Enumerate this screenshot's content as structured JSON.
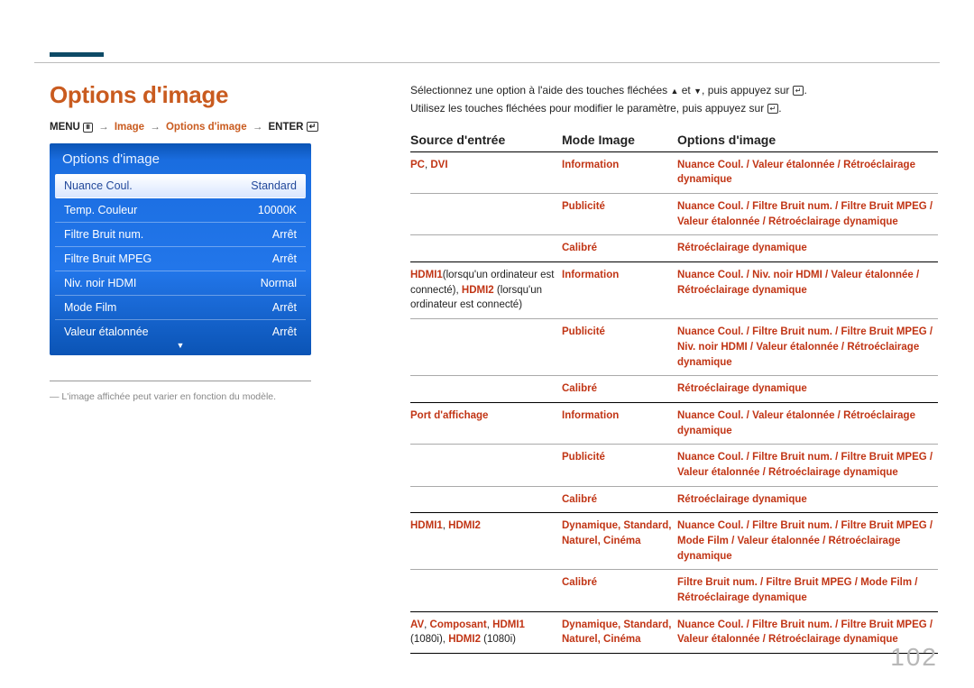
{
  "heading": "Options d'image",
  "breadcrumb": {
    "menu": "MENU",
    "image": "Image",
    "options": "Options d'image",
    "enter": "ENTER"
  },
  "panel": {
    "title": "Options d'image",
    "rows": [
      {
        "label": "Nuance Coul.",
        "value": "Standard",
        "selected": true
      },
      {
        "label": "Temp. Couleur",
        "value": "10000K"
      },
      {
        "label": "Filtre Bruit num.",
        "value": "Arrêt"
      },
      {
        "label": "Filtre Bruit MPEG",
        "value": "Arrêt"
      },
      {
        "label": "Niv. noir HDMI",
        "value": "Normal"
      },
      {
        "label": "Mode Film",
        "value": "Arrêt"
      },
      {
        "label": "Valeur étalonnée",
        "value": "Arrêt"
      }
    ]
  },
  "footnote": "― L'image affichée peut varier en fonction du modèle.",
  "desc": {
    "line1a": "Sélectionnez une option à l'aide des touches fléchées ",
    "line1b": " et ",
    "line1c": ", puis appuyez sur ",
    "line1d": ".",
    "line2a": "Utilisez les touches fléchées pour modifier le paramètre, puis appuyez sur ",
    "line2b": "."
  },
  "table": {
    "headers": {
      "c1": "Source d'entrée",
      "c2": "Mode Image",
      "c3": "Options d'image"
    },
    "groups": [
      {
        "source": [
          {
            "t": "PC",
            "r": true
          },
          {
            "t": ", ",
            "r": false
          },
          {
            "t": "DVI",
            "r": true
          }
        ],
        "rows": [
          {
            "mode": "Information",
            "opts": [
              {
                "t": "Nuance Coul.",
                "r": true
              },
              {
                "t": " / ",
                "r": true
              },
              {
                "t": "Valeur étalonnée",
                "r": true
              },
              {
                "t": " / ",
                "r": true
              },
              {
                "t": "Rétroéclairage dynamique",
                "r": true
              }
            ]
          },
          {
            "mode": "Publicité",
            "opts": [
              {
                "t": "Nuance Coul.",
                "r": true
              },
              {
                "t": " / ",
                "r": true
              },
              {
                "t": "Filtre Bruit num.",
                "r": true
              },
              {
                "t": " / ",
                "r": true
              },
              {
                "t": "Filtre Bruit MPEG",
                "r": true
              },
              {
                "t": " / ",
                "r": true
              },
              {
                "t": "Valeur étalonnée",
                "r": true
              },
              {
                "t": " / ",
                "r": true
              },
              {
                "t": "Rétroéclairage dynamique",
                "r": true
              }
            ]
          },
          {
            "mode": "Calibré",
            "opts": [
              {
                "t": "Rétroéclairage dynamique",
                "r": true
              }
            ]
          }
        ]
      },
      {
        "source": [
          {
            "t": "HDMI1",
            "r": true
          },
          {
            "t": "(lorsqu'un ordinateur est connecté), ",
            "r": false
          },
          {
            "t": "HDMI2",
            "r": true
          },
          {
            "t": " (lorsqu'un ordinateur est connecté)",
            "r": false
          }
        ],
        "rows": [
          {
            "mode": "Information",
            "opts": [
              {
                "t": "Nuance Coul.",
                "r": true
              },
              {
                "t": " / ",
                "r": true
              },
              {
                "t": "Niv. noir HDMI",
                "r": true
              },
              {
                "t": " / ",
                "r": true
              },
              {
                "t": "Valeur étalonnée",
                "r": true
              },
              {
                "t": " / ",
                "r": true
              },
              {
                "t": "Rétroéclairage dynamique",
                "r": true
              }
            ]
          },
          {
            "mode": "Publicité",
            "opts": [
              {
                "t": "Nuance Coul.",
                "r": true
              },
              {
                "t": " / ",
                "r": true
              },
              {
                "t": "Filtre Bruit num.",
                "r": true
              },
              {
                "t": " / ",
                "r": true
              },
              {
                "t": "Filtre Bruit MPEG",
                "r": true
              },
              {
                "t": " / ",
                "r": true
              },
              {
                "t": "Niv. noir HDMI",
                "r": true
              },
              {
                "t": " / ",
                "r": true
              },
              {
                "t": "Valeur étalonnée",
                "r": true
              },
              {
                "t": " / ",
                "r": true
              },
              {
                "t": "Rétroéclairage dynamique",
                "r": true
              }
            ]
          },
          {
            "mode": "Calibré",
            "opts": [
              {
                "t": "Rétroéclairage dynamique",
                "r": true
              }
            ]
          }
        ]
      },
      {
        "source": [
          {
            "t": "Port d'affichage",
            "r": true
          }
        ],
        "rows": [
          {
            "mode": "Information",
            "opts": [
              {
                "t": "Nuance Coul.",
                "r": true
              },
              {
                "t": " / ",
                "r": true
              },
              {
                "t": "Valeur étalonnée",
                "r": true
              },
              {
                "t": " / ",
                "r": true
              },
              {
                "t": "Rétroéclairage dynamique",
                "r": true
              }
            ]
          },
          {
            "mode": "Publicité",
            "opts": [
              {
                "t": "Nuance Coul.",
                "r": true
              },
              {
                "t": " / ",
                "r": true
              },
              {
                "t": "Filtre Bruit num.",
                "r": true
              },
              {
                "t": " / ",
                "r": true
              },
              {
                "t": "Filtre Bruit MPEG",
                "r": true
              },
              {
                "t": " / ",
                "r": true
              },
              {
                "t": "Valeur étalonnée",
                "r": true
              },
              {
                "t": " / ",
                "r": true
              },
              {
                "t": "Rétroéclairage dynamique",
                "r": true
              }
            ]
          },
          {
            "mode": "Calibré",
            "opts": [
              {
                "t": "Rétroéclairage dynamique",
                "r": true
              }
            ]
          }
        ]
      },
      {
        "source": [
          {
            "t": "HDMI1",
            "r": true
          },
          {
            "t": ", ",
            "r": false
          },
          {
            "t": "HDMI2",
            "r": true
          }
        ],
        "rows": [
          {
            "mode": "Dynamique, Standard, Naturel, Cinéma",
            "modeRed": true,
            "opts": [
              {
                "t": "Nuance Coul.",
                "r": true
              },
              {
                "t": " / ",
                "r": true
              },
              {
                "t": "Filtre Bruit num.",
                "r": true
              },
              {
                "t": " / ",
                "r": true
              },
              {
                "t": "Filtre Bruit MPEG",
                "r": true
              },
              {
                "t": " / ",
                "r": true
              },
              {
                "t": "Mode Film",
                "r": true
              },
              {
                "t": " / ",
                "r": true
              },
              {
                "t": "Valeur étalonnée",
                "r": true
              },
              {
                "t": " / ",
                "r": true
              },
              {
                "t": "Rétroéclairage dynamique",
                "r": true
              }
            ]
          },
          {
            "mode": "Calibré",
            "opts": [
              {
                "t": "Filtre Bruit num.",
                "r": true
              },
              {
                "t": " / ",
                "r": true
              },
              {
                "t": "Filtre Bruit MPEG",
                "r": true
              },
              {
                "t": " / ",
                "r": true
              },
              {
                "t": "Mode Film",
                "r": true
              },
              {
                "t": " / ",
                "r": true
              },
              {
                "t": "Rétroéclairage dynamique",
                "r": true
              }
            ]
          }
        ]
      },
      {
        "source": [
          {
            "t": "AV",
            "r": true
          },
          {
            "t": ", ",
            "r": false
          },
          {
            "t": "Composant",
            "r": true
          },
          {
            "t": ", ",
            "r": false
          },
          {
            "t": "HDMI1",
            "r": true
          },
          {
            "t": " (1080i), ",
            "r": false
          },
          {
            "t": "HDMI2",
            "r": true
          },
          {
            "t": " (1080i)",
            "r": false
          }
        ],
        "rows": [
          {
            "mode": "Dynamique, Standard, Naturel, Cinéma",
            "modeRed": true,
            "opts": [
              {
                "t": "Nuance Coul.",
                "r": true
              },
              {
                "t": " / ",
                "r": true
              },
              {
                "t": "Filtre Bruit num.",
                "r": true
              },
              {
                "t": " / ",
                "r": true
              },
              {
                "t": "Filtre Bruit MPEG",
                "r": true
              },
              {
                "t": " / ",
                "r": true
              },
              {
                "t": "Valeur étalonnée",
                "r": true
              },
              {
                "t": " / ",
                "r": true
              },
              {
                "t": "Rétroéclairage dynamique",
                "r": true
              }
            ]
          }
        ]
      }
    ]
  },
  "pagenum": "102"
}
